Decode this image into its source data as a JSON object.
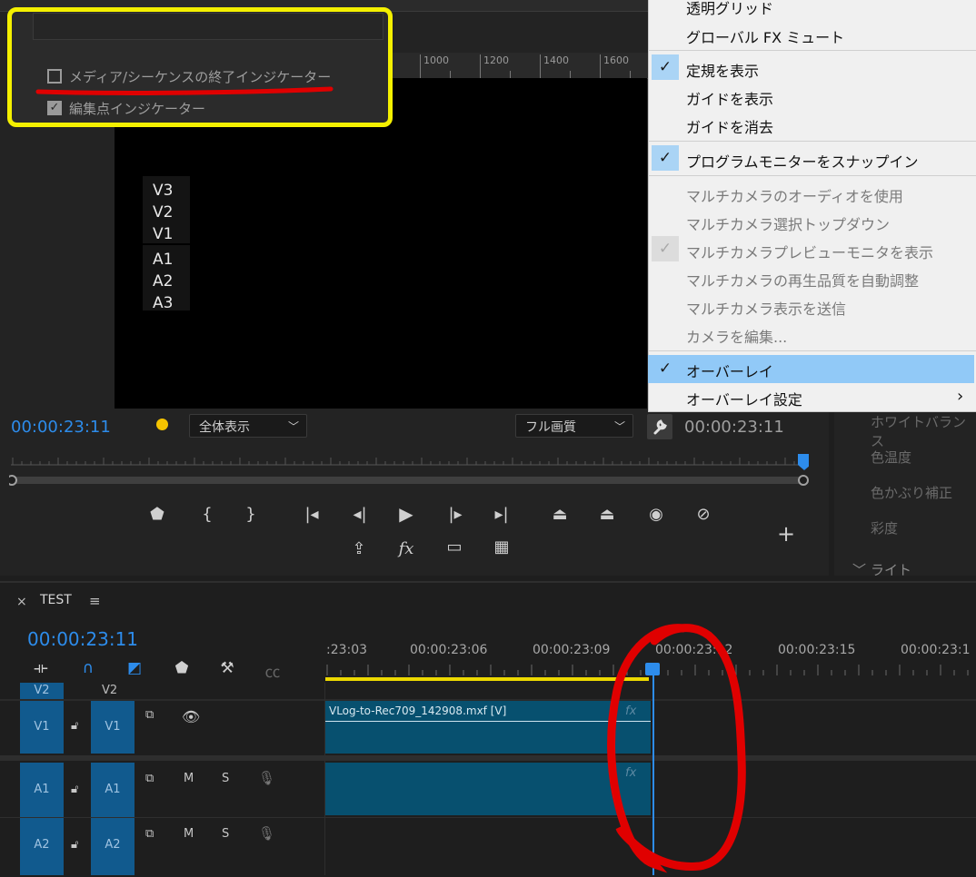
{
  "monitor": {
    "ruler_labels": [
      "1000",
      "1200",
      "1400",
      "1600"
    ],
    "track_labels": [
      "V3",
      "V2",
      "V1",
      "A1",
      "A2",
      "A3"
    ],
    "timecode_current": "00:00:23:11",
    "timecode_duration": "00:00:23:11",
    "zoom_select": "全体表示",
    "quality_select": "フル画質",
    "controls": [
      "marker-button",
      "mark-in-button",
      "mark-out-button",
      "go-to-in-button",
      "step-back-button",
      "play-button",
      "step-forward-button",
      "go-to-out-button",
      "lift-button",
      "extract-button",
      "export-frame-button",
      "comparison-view-button"
    ],
    "controls_row2": [
      "insert-button",
      "fx-toggle-button",
      "safe-margins-button",
      "multi-camera-button"
    ]
  },
  "lumetri": {
    "items": [
      "ホワイトバランス",
      "色温度",
      "色かぶり補正",
      "彩度",
      "ライト"
    ]
  },
  "timeline": {
    "tab_close": "×",
    "tab_name": "TEST",
    "tab_menu": "≡",
    "timecode": "00:00:23:11",
    "ruler_labels": [
      ":23:03",
      "00:00:23:06",
      "00:00:23:09",
      "00:00:23:12",
      "00:00:23:15",
      "00:00:23:1"
    ],
    "tracks": {
      "v2_src": "V2",
      "v2_target": "V2",
      "v1_src": "V1",
      "v1_target": "V1",
      "a1_src": "A1",
      "a1_target": "A1",
      "a2_src": "A2",
      "a2_target": "A2",
      "mute": "M",
      "solo": "S"
    },
    "clip_name": "VLog-to-Rec709_142908.mxf [V]",
    "fx_label": "fx"
  },
  "context_menu": {
    "items": [
      {
        "label": "透明グリッド",
        "checked": false,
        "disabled": false
      },
      {
        "label": "グローバル FX ミュート",
        "checked": false,
        "disabled": false
      },
      {
        "label": "定規を表示",
        "checked": true,
        "disabled": false
      },
      {
        "label": "ガイドを表示",
        "checked": false,
        "disabled": false
      },
      {
        "label": "ガイドを消去",
        "checked": false,
        "disabled": false
      },
      {
        "label": "プログラムモニターをスナップイン",
        "checked": true,
        "disabled": false
      },
      {
        "label": "マルチカメラのオーディオを使用",
        "checked": false,
        "disabled": true
      },
      {
        "label": "マルチカメラ選択トップダウン",
        "checked": false,
        "disabled": true
      },
      {
        "label": "マルチカメラプレビューモニタを表示",
        "checked": true,
        "disabled": true
      },
      {
        "label": "マルチカメラの再生品質を自動調整",
        "checked": false,
        "disabled": true
      },
      {
        "label": "マルチカメラ表示を送信",
        "checked": false,
        "disabled": true
      },
      {
        "label": "カメラを編集...",
        "checked": false,
        "disabled": true
      },
      {
        "label": "オーバーレイ",
        "checked": true,
        "disabled": false,
        "highlighted": true
      },
      {
        "label": "オーバーレイ設定",
        "checked": false,
        "disabled": false,
        "submenu": true
      }
    ],
    "check_glyph": "✓",
    "submenu_glyph": "›"
  },
  "overlay_popup": {
    "option1": {
      "label": "メディア/シーケンスの終了インジケーター",
      "checked": false
    },
    "option2": {
      "label": "編集点インジケーター",
      "checked": true
    }
  },
  "colors": {
    "timecode_blue": "#2d8ceb",
    "clip_teal": "#07506f",
    "highlight_yellow": "#f4f000",
    "annotation_red": "#e00000",
    "menu_highlight": "#91c9f7"
  }
}
